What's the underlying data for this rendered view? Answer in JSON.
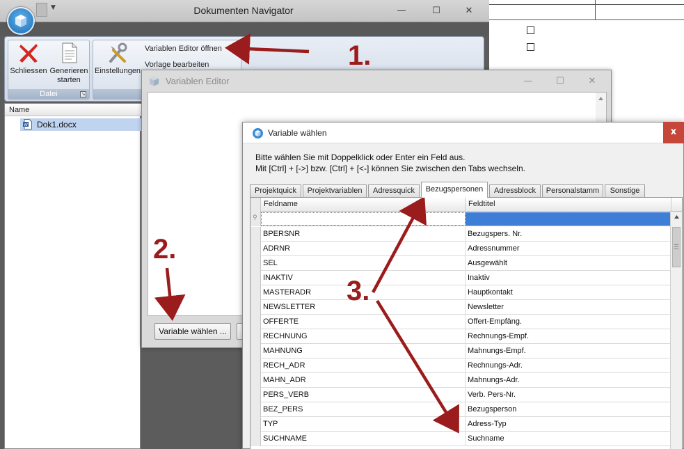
{
  "navigator": {
    "title": "Dokumenten Navigator",
    "window_controls": {
      "minimize": "—",
      "maximize": "☐",
      "close": "✕"
    },
    "ribbon": {
      "group_datei": {
        "label": "Datei",
        "close_label": "Schliessen",
        "generate_label_line1": "Generieren",
        "generate_label_line2": "starten"
      },
      "group_settings": {
        "settings_label": "Einstellungen",
        "open_editor_label": "Variablen Editor öffnen",
        "edit_template_label": "Vorlage bearbeiten"
      }
    },
    "tree": {
      "column_header": "Name",
      "items": [
        "Dok1.docx"
      ]
    }
  },
  "variablen_editor": {
    "title": "Variablen Editor",
    "choose_variable_button": "Variable wählen ..."
  },
  "variable_waehlen": {
    "title": "Variable wählen",
    "close_label": "x",
    "instruction_line1": "Bitte wählen Sie mit Doppelklick oder Enter ein Feld aus.",
    "instruction_line2": "Mit [Ctrl] + [->] bzw. [Ctrl] + [<-] können Sie zwischen den Tabs wechseln.",
    "tabs": [
      "Projektquick",
      "Projektvariablen",
      "Adressquick",
      "Bezugspersonen",
      "Adressblock",
      "Personalstamm",
      "Sonstige"
    ],
    "active_tab": "Bezugspersonen",
    "columns": [
      "Feldname",
      "Feldtitel"
    ],
    "rows": [
      {
        "feldname": "BPERSNR",
        "feldtitel": "Bezugspers. Nr."
      },
      {
        "feldname": "ADRNR",
        "feldtitel": "Adressnummer"
      },
      {
        "feldname": "SEL",
        "feldtitel": "Ausgewählt"
      },
      {
        "feldname": "INAKTIV",
        "feldtitel": "Inaktiv"
      },
      {
        "feldname": "MASTERADR",
        "feldtitel": "Hauptkontakt"
      },
      {
        "feldname": "NEWSLETTER",
        "feldtitel": "Newsletter"
      },
      {
        "feldname": "OFFERTE",
        "feldtitel": "Offert-Empfäng."
      },
      {
        "feldname": "RECHNUNG",
        "feldtitel": "Rechnungs-Empf."
      },
      {
        "feldname": "MAHNUNG",
        "feldtitel": "Mahnungs-Empf."
      },
      {
        "feldname": "RECH_ADR",
        "feldtitel": "Rechnungs-Adr."
      },
      {
        "feldname": "MAHN_ADR",
        "feldtitel": "Mahnungs-Adr."
      },
      {
        "feldname": "PERS_VERB",
        "feldtitel": "Verb. Pers-Nr."
      },
      {
        "feldname": "BEZ_PERS",
        "feldtitel": "Bezugsperson"
      },
      {
        "feldname": "TYP",
        "feldtitel": "Adress-Typ"
      },
      {
        "feldname": "SUCHNAME",
        "feldtitel": "Suchname"
      }
    ]
  },
  "annotations": {
    "step1": "1.",
    "step2": "2.",
    "step3": "3.",
    "arrow_color": "#9b1c1c"
  },
  "colors": {
    "accent_blue": "#3f7ed6",
    "selection_blue": "#c0d3ef",
    "close_red": "#c7463a"
  }
}
